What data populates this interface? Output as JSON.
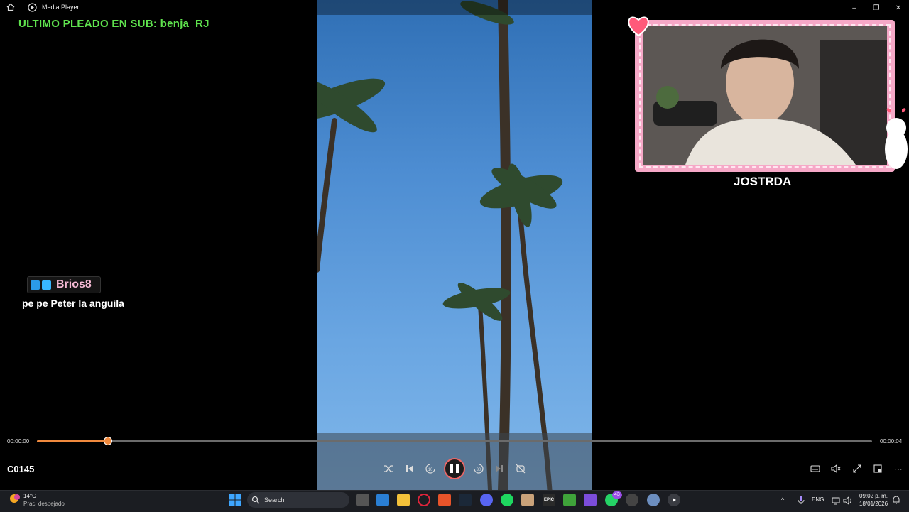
{
  "titlebar": {
    "title": "Media Player"
  },
  "overlay": {
    "sub_banner": "ULTIMO PLEADO EN SUB: benja_RJ",
    "chat_user": "Brios8",
    "chat_message": "pe pe Peter la anguila",
    "cam_name": "JOSTRDA"
  },
  "player": {
    "time_current": "00:00:00",
    "time_total": "00:00:04",
    "progress_fraction": 0.085,
    "media_title": "C0145",
    "controls": [
      "shuffle",
      "previous",
      "skip-back-10",
      "pause",
      "skip-forward-30",
      "next",
      "repeat-off"
    ],
    "skip_back_label": "10",
    "skip_forward_label": "30",
    "right_controls": [
      "captions",
      "mute",
      "fullscreen",
      "mini-player",
      "more"
    ]
  },
  "taskbar": {
    "weather_temp": "14°C",
    "weather_desc": "Prac. despejado",
    "search_label": "Search",
    "apps": [
      "start",
      "search",
      "task-view",
      "widgets",
      "file-explorer",
      "opera",
      "brave",
      "steam",
      "discord",
      "spotify",
      "files",
      "epic-games",
      "minecraft",
      "obsidian",
      "whatsapp",
      "chrome",
      "settings",
      "media-player"
    ],
    "whatsapp_badge": "43",
    "language": "ENG",
    "time": "09:02 p. m.",
    "date": "18/01/2026"
  },
  "colors": {
    "accent": "#f08a3e",
    "sub_banner": "#5fe34e",
    "cam_frame": "#f6a8c7",
    "chat_user": "#f5b9d4"
  }
}
